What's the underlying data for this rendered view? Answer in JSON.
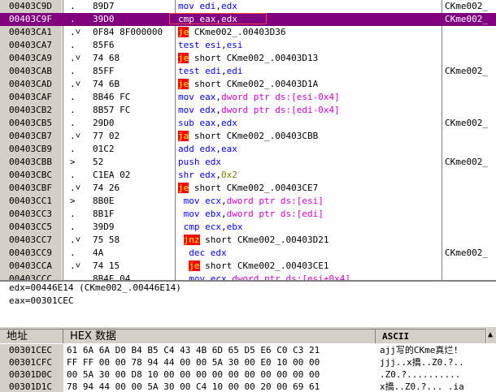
{
  "disasm": [
    {
      "addr": "00403C9D",
      "mark": ".",
      "hex": "89D7",
      "asm": [
        [
          "mov ",
          "b"
        ],
        [
          "edi,edx",
          "b"
        ]
      ],
      "cmt": "mov edi,edx",
      "cm": "CKme002_"
    },
    {
      "addr": "00403C9F",
      "mark": ".",
      "hex": "39D0",
      "asm": [],
      "cmt": "",
      "cm": "CKme002_",
      "sel": true
    },
    {
      "addr": "00403CA1",
      "mark": ".v",
      "hex": "0F84 8F000000",
      "cm": ""
    },
    {
      "addr": "00403CA7",
      "mark": ".",
      "hex": "85F6",
      "cm": ""
    },
    {
      "addr": "00403CA9",
      "mark": ".v",
      "hex": "74 68",
      "cm": ""
    },
    {
      "addr": "00403CAB",
      "mark": ".",
      "hex": "85FF",
      "cm": "CKme002_"
    },
    {
      "addr": "00403CAD",
      "mark": ".v",
      "hex": "74 6B",
      "cm": ""
    },
    {
      "addr": "00403CAF",
      "mark": ".",
      "hex": "8B46 FC",
      "cm": ""
    },
    {
      "addr": "00403CB2",
      "mark": ".",
      "hex": "8B57 FC",
      "cm": ""
    },
    {
      "addr": "00403CB5",
      "mark": ".",
      "hex": "29D0",
      "cm": "CKme002_"
    },
    {
      "addr": "00403CB7",
      "mark": ".v",
      "hex": "77 02",
      "cm": ""
    },
    {
      "addr": "00403CB9",
      "mark": ".",
      "hex": "01C2",
      "cm": ""
    },
    {
      "addr": "00403CBB",
      "mark": ">",
      "hex": "52",
      "cm": "CKme002_"
    },
    {
      "addr": "00403CBC",
      "mark": ".",
      "hex": "C1EA 02",
      "cm": ""
    },
    {
      "addr": "00403CBF",
      "mark": ".v",
      "hex": "74 26",
      "cm": ""
    },
    {
      "addr": "00403CC1",
      "mark": ">",
      "hex": "8B0E",
      "cm": ""
    },
    {
      "addr": "00403CC3",
      "mark": ".",
      "hex": "8B1F",
      "cm": ""
    },
    {
      "addr": "00403CC5",
      "mark": ".",
      "hex": "39D9",
      "cm": ""
    },
    {
      "addr": "00403CC7",
      "mark": ".v",
      "hex": "75 58",
      "cm": ""
    },
    {
      "addr": "00403CC9",
      "mark": ".",
      "hex": "4A",
      "cm": "CKme002_"
    },
    {
      "addr": "00403CCA",
      "mark": ".v",
      "hex": "74 15",
      "cm": ""
    },
    {
      "addr": "00403CCC",
      "mark": ".",
      "hex": "8B4E 04",
      "cm": ""
    }
  ],
  "asm_text": [
    "mov edi,edx",
    "cmp eax,edx",
    "je CKme002_.00403D36",
    "test esi,esi",
    "je short CKme002_.00403D13",
    "test edi,edi",
    "je short CKme002_.00403D1A",
    "mov eax,dword ptr ds:[esi-0x4]",
    "mov edx,dword ptr ds:[edi-0x4]",
    "sub eax,edx",
    "ja short CKme002_.00403CBB",
    "add edx,eax",
    "push edx",
    "shr edx,0x2",
    "je short CKme002_.00403CE7",
    "mov ecx,dword ptr ds:[esi]",
    "mov ebx,dword ptr ds:[edi]",
    "cmp ecx,ebx",
    "jnz short CKme002_.00403D21",
    "dec edx",
    "je short CKme002_.00403CE1",
    "mov ecx,dword ptr ds:[esi+0x4]"
  ],
  "info": {
    "line1": "edx=00446E14 (CKme002_.00446E14)",
    "line2": "eax=00301CEC"
  },
  "dump_header": {
    "addr": "地址",
    "hex": "HEX 数据",
    "ascii": "ASCII"
  },
  "dump": [
    {
      "addr": "00301CEC",
      "hex": "61 6A 6A D0 B4 B5 C4 43 4B 6D 65 D5 E6 C0 C3 21",
      "ascii": "ajj写的CKme真烂!"
    },
    {
      "addr": "00301CFC",
      "hex": "FF FF 00 00 78 94 44 00 00 5A 30 00 E0 10 00 00",
      "ascii": "jjj..x撟..Z0.?.."
    },
    {
      "addr": "00301D0C",
      "hex": "00 5A 30 00 D8 10 00 00 00 00 00 00 00 00 00 00",
      "ascii": ".Z0.?.........."
    },
    {
      "addr": "00301D1C",
      "hex": "78 94 44 00 00 5A 30 00 C4 10 00 00 20 00 69 61",
      "ascii": "x撟..Z0.?... .ia"
    }
  ],
  "colors": {
    "selected_row": "#800080",
    "jump_bg": "#ff0000",
    "jump_fg": "#ffff00",
    "register": "#0000ff",
    "memory": "#d000d0"
  }
}
